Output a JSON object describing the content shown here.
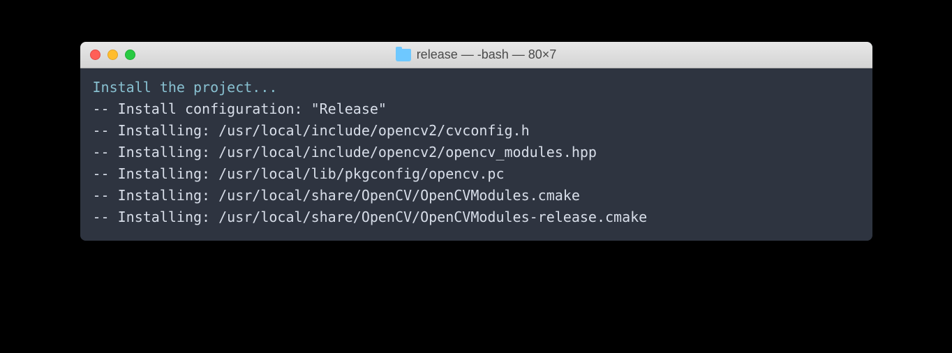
{
  "window": {
    "title": "release — -bash — 80×7"
  },
  "terminal": {
    "lines": [
      {
        "cls": "teal",
        "text": "Install the project..."
      },
      {
        "cls": "gray",
        "text": "-- Install configuration: \"Release\""
      },
      {
        "cls": "gray",
        "text": "-- Installing: /usr/local/include/opencv2/cvconfig.h"
      },
      {
        "cls": "gray",
        "text": "-- Installing: /usr/local/include/opencv2/opencv_modules.hpp"
      },
      {
        "cls": "gray",
        "text": "-- Installing: /usr/local/lib/pkgconfig/opencv.pc"
      },
      {
        "cls": "gray",
        "text": "-- Installing: /usr/local/share/OpenCV/OpenCVModules.cmake"
      },
      {
        "cls": "gray",
        "text": "-- Installing: /usr/local/share/OpenCV/OpenCVModules-release.cmake"
      }
    ]
  }
}
